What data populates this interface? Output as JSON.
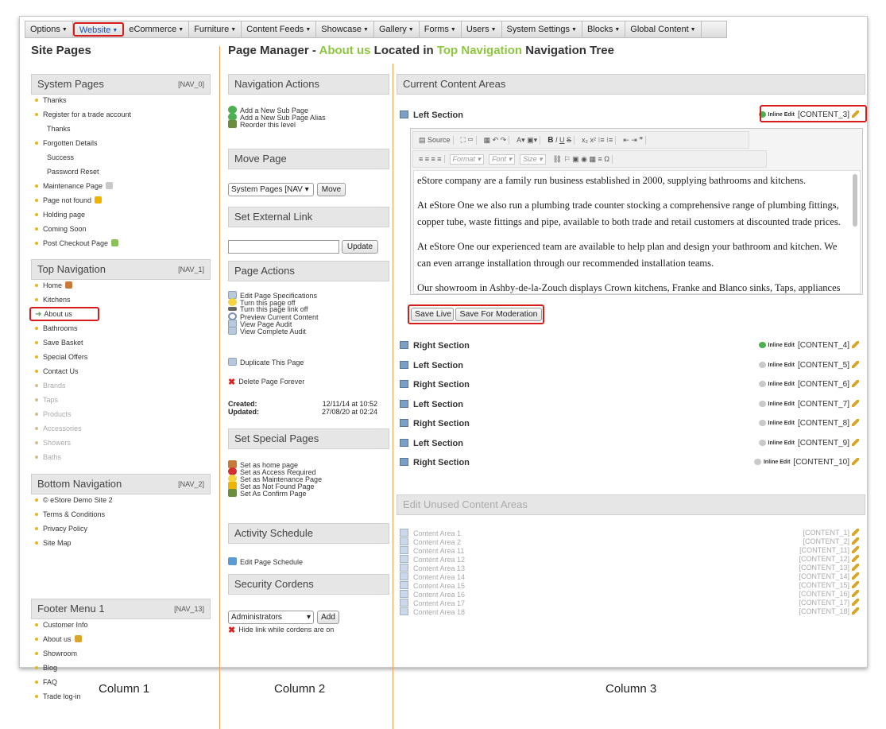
{
  "menu": [
    {
      "label": "Options",
      "active": false
    },
    {
      "label": "Website",
      "active": true
    },
    {
      "label": "eCommerce",
      "active": false
    },
    {
      "label": "Furniture",
      "active": false
    },
    {
      "label": "Content Feeds",
      "active": false
    },
    {
      "label": "Showcase",
      "active": false
    },
    {
      "label": "Gallery",
      "active": false
    },
    {
      "label": "Forms",
      "active": false
    },
    {
      "label": "Users",
      "active": false
    },
    {
      "label": "System Settings",
      "active": false
    },
    {
      "label": "Blocks",
      "active": false
    },
    {
      "label": "Global Content",
      "active": false
    }
  ],
  "site_pages": {
    "title": "Site Pages",
    "groups": [
      {
        "name": "System Pages",
        "tag": "[NAV_0]",
        "items": [
          {
            "label": "Thanks",
            "bullet": true,
            "dim": false
          },
          {
            "label": "Register for a trade account",
            "bullet": true,
            "dim": false
          },
          {
            "label": "Thanks",
            "bullet": false,
            "dim": false
          },
          {
            "label": "Forgotten Details",
            "bullet": true,
            "dim": false
          },
          {
            "label": "Success",
            "bullet": false,
            "dim": false
          },
          {
            "label": "Password Reset",
            "bullet": false,
            "dim": false
          },
          {
            "label": "Maintenance Page",
            "bullet": true,
            "dim": false,
            "icon": "maintenance-icon"
          },
          {
            "label": "Page not found",
            "bullet": true,
            "dim": false,
            "icon": "warning-icon"
          },
          {
            "label": "Holding page",
            "bullet": true,
            "dim": false
          },
          {
            "label": "Coming Soon",
            "bullet": true,
            "dim": false
          },
          {
            "label": "Post Checkout Page",
            "bullet": true,
            "dim": false,
            "icon": "confirm-icon"
          }
        ]
      },
      {
        "name": "Top Navigation",
        "tag": "[NAV_1]",
        "items": [
          {
            "label": "Home",
            "bullet": true,
            "dim": false,
            "icon": "home-icon"
          },
          {
            "label": "Kitchens",
            "bullet": true,
            "dim": false
          },
          {
            "label": "About us",
            "bullet": "arrow",
            "dim": false,
            "selected": true
          },
          {
            "label": "Bathrooms",
            "bullet": true,
            "dim": false
          },
          {
            "label": "Save Basket",
            "bullet": true,
            "dim": false
          },
          {
            "label": "Special Offers",
            "bullet": true,
            "dim": false
          },
          {
            "label": "Contact Us",
            "bullet": true,
            "dim": false
          },
          {
            "label": "Brands",
            "bullet": true,
            "dim": true
          },
          {
            "label": "Taps",
            "bullet": true,
            "dim": true
          },
          {
            "label": "Products",
            "bullet": true,
            "dim": true
          },
          {
            "label": "Accessories",
            "bullet": true,
            "dim": true
          },
          {
            "label": "Showers",
            "bullet": true,
            "dim": true
          },
          {
            "label": "Baths",
            "bullet": true,
            "dim": true
          }
        ]
      },
      {
        "name": "Bottom Navigation",
        "tag": "[NAV_2]",
        "items": [
          {
            "label": "© eStore Demo Site 2",
            "bullet": true,
            "dim": false
          },
          {
            "label": "Terms & Conditions",
            "bullet": true,
            "dim": false
          },
          {
            "label": "Privacy Policy",
            "bullet": true,
            "dim": false
          },
          {
            "label": "Site Map",
            "bullet": true,
            "dim": false
          }
        ]
      },
      {
        "name": "Footer Menu 1",
        "tag": "[NAV_13]",
        "items": [
          {
            "label": "Customer Info",
            "bullet": true,
            "dim": false
          },
          {
            "label": "About us",
            "bullet": true,
            "dim": false,
            "icon": "pencil-icon"
          },
          {
            "label": "Showroom",
            "bullet": true,
            "dim": false
          },
          {
            "label": "Blog",
            "bullet": true,
            "dim": false
          },
          {
            "label": "FAQ",
            "bullet": true,
            "dim": false
          },
          {
            "label": "Trade log-in",
            "bullet": true,
            "dim": false
          }
        ]
      }
    ]
  },
  "header": {
    "prefix": "Page Manager - ",
    "page": "About us",
    "middle": " Located in ",
    "tree": "Top Navigation",
    "suffix": " Navigation Tree"
  },
  "col2": {
    "navigation_actions": {
      "title": "Navigation Actions",
      "items": [
        "Add a New Sub Page",
        "Add a New Sub Page Alias",
        "Reorder this level"
      ]
    },
    "move_page": {
      "title": "Move Page",
      "select": "System Pages [NAV",
      "button": "Move"
    },
    "external_link": {
      "title": "Set External Link",
      "placeholder": "",
      "button": "Update"
    },
    "page_actions": {
      "title": "Page Actions",
      "items": [
        "Edit Page Specifications",
        "Turn this page off",
        "Turn this page link off",
        "Preview Current Content",
        "View Page Audit",
        "View Complete Audit"
      ],
      "duplicate": "Duplicate This Page",
      "delete": "Delete Page Forever"
    },
    "created_label": "Created:",
    "created_value": "12/11/14 at 10:52",
    "updated_label": "Updated:",
    "updated_value": "27/08/20 at 02:24",
    "special_pages": {
      "title": "Set Special Pages",
      "items": [
        "Set as home page",
        "Set as Access Required",
        "Set as Maintenance Page",
        "Set as Not Found Page",
        "Set As Confirm Page"
      ]
    },
    "activity": {
      "title": "Activity Schedule",
      "item": "Edit Page Schedule"
    },
    "security": {
      "title": "Security Cordens",
      "select": "Administrators",
      "button": "Add",
      "hide": "Hide link while cordens are on"
    }
  },
  "col3": {
    "current_title": "Current Content Areas",
    "left_section": "Left Section",
    "inline_edit": "Inline Edit",
    "toolbar": {
      "source": "Source",
      "format": "Format",
      "font": "Font",
      "size": "Size"
    },
    "editor_paragraphs": [
      "eStore company are a family run business established in 2000, supplying bathrooms and kitchens.",
      "At eStore One we also run a plumbing trade counter stocking a comprehensive range of plumbing fittings, copper tube, waste fittings and pipe, available to both trade and retail customers at discounted trade prices.",
      "At eStore One our experienced team are available to help plan and design your bathroom and kitchen. We can even arrange installation through our recommended installation teams.",
      "Our showroom in Ashby-de-la-Zouch displays Crown kitchens, Franke and Blanco sinks, Taps, appliances and"
    ],
    "save_live": "Save Live",
    "save_moderation": "Save For Moderation",
    "sections": [
      {
        "label": "Left Section",
        "tag": "[CONTENT_3]",
        "live": true
      },
      {
        "label": "Right Section",
        "tag": "[CONTENT_4]",
        "live": true
      },
      {
        "label": "Left Section",
        "tag": "[CONTENT_5]",
        "live": false
      },
      {
        "label": "Right Section",
        "tag": "[CONTENT_6]",
        "live": false
      },
      {
        "label": "Left Section",
        "tag": "[CONTENT_7]",
        "live": false
      },
      {
        "label": "Right Section",
        "tag": "[CONTENT_8]",
        "live": false
      },
      {
        "label": "Left Section",
        "tag": "[CONTENT_9]",
        "live": false
      },
      {
        "label": "Right Section",
        "tag": "[CONTENT_10]",
        "live": false
      }
    ],
    "unused_title": "Edit Unused Content Areas",
    "unused": [
      {
        "label": "Content Area 1",
        "tag": "[CONTENT_1]"
      },
      {
        "label": "Content Area 2",
        "tag": "[CONTENT_2]"
      },
      {
        "label": "Content Area 11",
        "tag": "[CONTENT_11]"
      },
      {
        "label": "Content Area 12",
        "tag": "[CONTENT_12]"
      },
      {
        "label": "Content Area 13",
        "tag": "[CONTENT_13]"
      },
      {
        "label": "Content Area 14",
        "tag": "[CONTENT_14]"
      },
      {
        "label": "Content Area 15",
        "tag": "[CONTENT_15]"
      },
      {
        "label": "Content Area 16",
        "tag": "[CONTENT_16]"
      },
      {
        "label": "Content Area 17",
        "tag": "[CONTENT_17]"
      },
      {
        "label": "Content Area 18",
        "tag": "[CONTENT_18]"
      }
    ]
  },
  "column_labels": [
    "Column 1",
    "Column 2",
    "Column 3"
  ],
  "colors": {
    "accent": "#8dc63f",
    "highlight_box": "#d81c1c",
    "separator": "#f0a050"
  }
}
